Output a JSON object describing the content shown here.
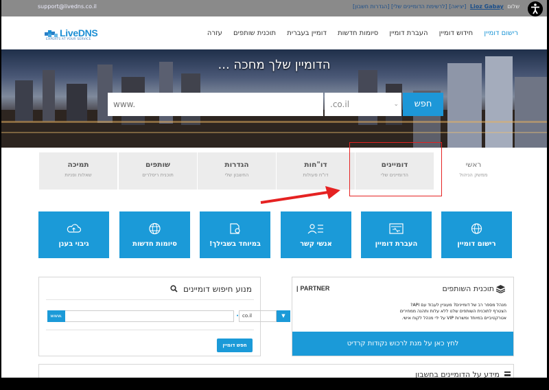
{
  "topbar": {
    "support_email": "support@livedns.co.il",
    "greeting": "שלום",
    "user_name": "Lioz Gabay",
    "links": "[יציאה]  [לרשימת הדומיינים שלי]  [הגדרות חשבון]"
  },
  "logo": {
    "name": "LiveDNS",
    "tagline": "EXPERTS AT YOUR SERVICE"
  },
  "nav": [
    "רישום דומיין",
    "חידוש דומיין",
    "העברת דומיין",
    "סיומות חדשות",
    "דומיין בעברית",
    "תוכנית שותפים",
    "עזרה"
  ],
  "hero": {
    "headline": "הדומיין שלך מחכה ...",
    "search_placeholder": "www.",
    "tld": ".co.il",
    "search_button": "חפש"
  },
  "tabs": [
    {
      "title": "ראשי",
      "subtitle": "ממשק הניהול"
    },
    {
      "title": "דומיינים",
      "subtitle": "הדומיינים שלי"
    },
    {
      "title": "דו\"חות",
      "subtitle": "דו\"ח פעולות"
    },
    {
      "title": "הגדרות",
      "subtitle": "החשבון שלי"
    },
    {
      "title": "שותפים",
      "subtitle": "תוכנית ריסלרים"
    },
    {
      "title": "תמיכה",
      "subtitle": "שאלות ופניות"
    }
  ],
  "tiles": [
    {
      "label": "רישום דומיין",
      "icon": "globe-plus-icon"
    },
    {
      "label": "העברת דומיין",
      "icon": "transfer-icon"
    },
    {
      "label": "אנשי קשר",
      "icon": "contacts-icon"
    },
    {
      "label": "במיוחד בשבילך!",
      "icon": "special-icon"
    },
    {
      "label": "סיומות חדשות",
      "icon": "globe-icon"
    },
    {
      "label": "גיבוי בענן",
      "icon": "cloud-backup-icon"
    }
  ],
  "domain_search": {
    "title": "מנוע חיפוש דומיינים",
    "prefix": "www.",
    "tld": "co.il",
    "button": "חפש דומיין"
  },
  "partner": {
    "title": "תוכנית השותפים",
    "brand": "PARTNER",
    "line1": "מנהל מספר רב של דומיינים? מעוניין לעבוד עם API?",
    "line2": "הצטרף לתוכנית השותפים שלנו ללא עלות ותהנה ממחירים",
    "line3": "אטרקטיביים במיוחד ומשרות VIP על ידי מנהל לקוח אישי.",
    "cta": "לחץ כאן על מנת לרכוש נקודות קרדיט"
  },
  "bottom_panel": {
    "title": "מידע על הדומיינים בחשבון"
  },
  "colors": {
    "accent": "#1b9ad8",
    "highlight": "#e52222"
  }
}
